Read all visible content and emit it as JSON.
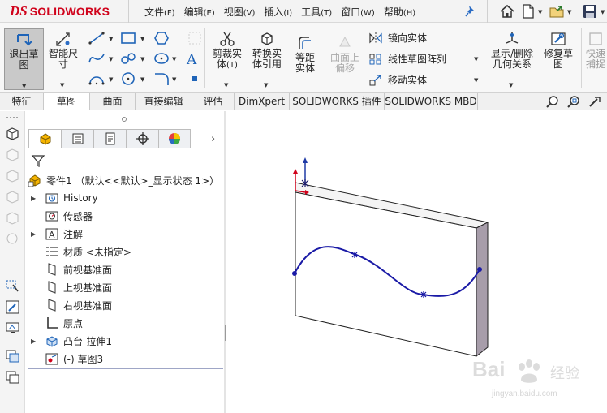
{
  "app": {
    "logo_ds": "DS",
    "logo_name": "SOLIDWORKS",
    "brand_color": "#d0021b"
  },
  "menu": [
    {
      "label": "文件",
      "key": "(F)"
    },
    {
      "label": "编辑",
      "key": "(E)"
    },
    {
      "label": "视图",
      "key": "(V)"
    },
    {
      "label": "插入",
      "key": "(I)"
    },
    {
      "label": "工具",
      "key": "(T)"
    },
    {
      "label": "窗口",
      "key": "(W)"
    },
    {
      "label": "帮助",
      "key": "(H)"
    }
  ],
  "ribbon": {
    "exit_sketch": "退出草图",
    "smart_dimension": "智能尺寸",
    "trim": "剪裁实体",
    "trim_key": "(T)",
    "convert": "转换实体引用",
    "offset": "等距实体",
    "offset_surface": "曲面上偏移",
    "mirror": "镜向实体",
    "linear_pattern": "线性草图阵列",
    "move": "移动实体",
    "display_relations": "显示/删除几何关系",
    "repair": "修复草图",
    "quick": "快速捕捉"
  },
  "command_tabs": [
    {
      "label": "特征",
      "active": false
    },
    {
      "label": "草图",
      "active": true
    },
    {
      "label": "曲面",
      "active": false
    },
    {
      "label": "直接编辑",
      "active": false
    },
    {
      "label": "评估",
      "active": false
    },
    {
      "label": "DimXpert",
      "active": false
    },
    {
      "label": "SOLIDWORKS 插件",
      "active": false
    },
    {
      "label": "SOLIDWORKS MBD",
      "active": false
    }
  ],
  "tree": {
    "root": "零件1 （默认<<默认>_显示状态 1>）",
    "items": [
      {
        "label": "History",
        "icon": "history-icon",
        "expandable": true
      },
      {
        "label": "传感器",
        "icon": "sensor-icon",
        "expandable": false
      },
      {
        "label": "注解",
        "icon": "annotation-icon",
        "expandable": true
      },
      {
        "label": "材质 <未指定>",
        "icon": "material-icon",
        "expandable": false
      },
      {
        "label": "前视基准面",
        "icon": "plane-icon",
        "expandable": false
      },
      {
        "label": "上视基准面",
        "icon": "plane-icon",
        "expandable": false
      },
      {
        "label": "右视基准面",
        "icon": "plane-icon",
        "expandable": false
      },
      {
        "label": "原点",
        "icon": "origin-icon",
        "expandable": false
      },
      {
        "label": "凸台-拉伸1",
        "icon": "extrude-icon",
        "expandable": true
      },
      {
        "label": "(-) 草图3",
        "icon": "sketch-icon",
        "expandable": false
      }
    ]
  },
  "graphics": {
    "curve_color": "#1a1aa6",
    "side_face_color": "#a79daa"
  },
  "watermark": {
    "main": "Bai",
    "cn": "经验",
    "url": "jingyan.baidu.com"
  }
}
